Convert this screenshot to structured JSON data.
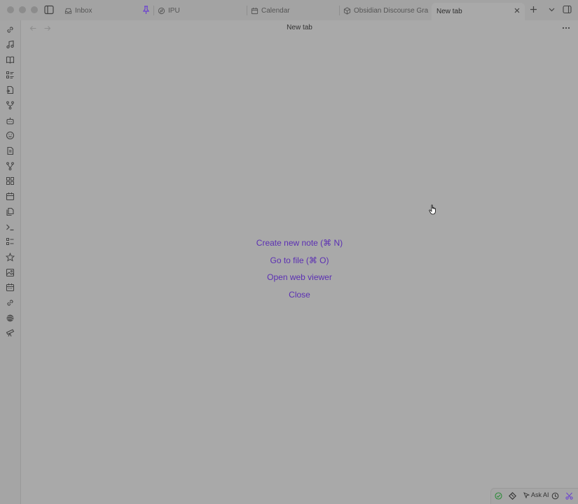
{
  "window": {
    "tabs": [
      {
        "label": "Inbox",
        "icon": "inbox-icon"
      },
      {
        "label": "IPU",
        "icon": "compass-icon"
      },
      {
        "label": "Calendar",
        "icon": "calendar-icon"
      },
      {
        "label": "Obsidian Discourse Gra...",
        "icon": "cube-icon"
      },
      {
        "label": "New tab",
        "icon": "",
        "active": true
      }
    ]
  },
  "ribbon": {
    "icons": [
      "link-icon",
      "music-icon",
      "book-icon",
      "list-icon",
      "file-swap-icon",
      "git-fork-icon",
      "robot-icon",
      "smiley-icon",
      "file-text-icon",
      "branch-icon",
      "grid-icon",
      "calendar-icon",
      "files-icon",
      "terminal-icon",
      "checklist-icon",
      "star-icon",
      "image-icon",
      "calendar-days-icon",
      "link-icon",
      "globe-icon",
      "telescope-icon"
    ]
  },
  "main": {
    "title": "New tab",
    "actions": [
      "Create new note (⌘ N)",
      "Go to file (⌘ O)",
      "Open web viewer",
      "Close"
    ]
  },
  "status": {
    "ask_ai": "Ask AI"
  },
  "colors": {
    "accent": "#5b2fb3",
    "background": "#a9a9a9"
  }
}
